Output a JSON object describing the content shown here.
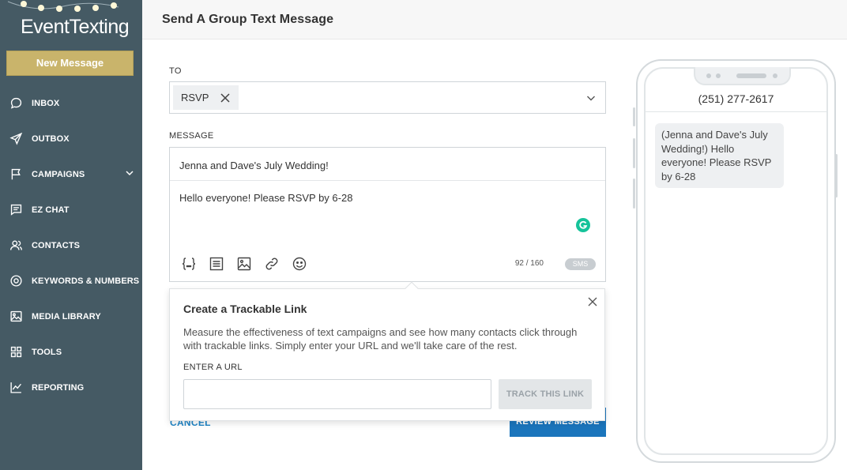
{
  "app": {
    "logo_text_1": "Event",
    "logo_text_2": "Texting",
    "new_message_label": "New Message"
  },
  "sidebar": {
    "items": [
      {
        "label": "INBOX",
        "icon": "chat-bubble-icon"
      },
      {
        "label": "OUTBOX",
        "icon": "paper-plane-icon"
      },
      {
        "label": "CAMPAIGNS",
        "icon": "flag-icon",
        "has_submenu": true
      },
      {
        "label": "EZ CHAT",
        "icon": "message-square-icon"
      },
      {
        "label": "CONTACTS",
        "icon": "users-icon"
      },
      {
        "label": "KEYWORDS & NUMBERS",
        "icon": "target-icon"
      },
      {
        "label": "MEDIA LIBRARY",
        "icon": "image-icon"
      },
      {
        "label": "TOOLS",
        "icon": "grid-icon"
      },
      {
        "label": "REPORTING",
        "icon": "line-chart-icon"
      }
    ]
  },
  "header": {
    "title": "Send A Group Text Message"
  },
  "form": {
    "to_label": "TO",
    "to_tags": [
      "RSVP"
    ],
    "message_label": "MESSAGE",
    "subject": "Jenna and Dave's July Wedding!",
    "body": "Hello everyone! Please RSVP by 6-28",
    "char_counter": "92 / 160",
    "message_type": "SMS",
    "cancel_label": "CANCEL",
    "review_label": "REVIEW MESSAGE"
  },
  "popover": {
    "title": "Create a Trackable Link",
    "description": "Measure the effectiveness of text campaigns and see how many contacts click through with trackable links. Simply enter your URL and we'll take care of the rest.",
    "url_label": "ENTER A URL",
    "url_value": "",
    "track_button": "TRACK THIS LINK"
  },
  "preview": {
    "phone_number": "(251) 277-2617",
    "bubble_text": "(Jenna and Dave's July Wedding!) Hello everyone! Please RSVP by 6-28"
  },
  "colors": {
    "sidebar_bg": "#455a64",
    "new_message_bg": "#c9b46b",
    "primary_blue": "#1b75bc",
    "grammarly_green": "#15c39a"
  }
}
